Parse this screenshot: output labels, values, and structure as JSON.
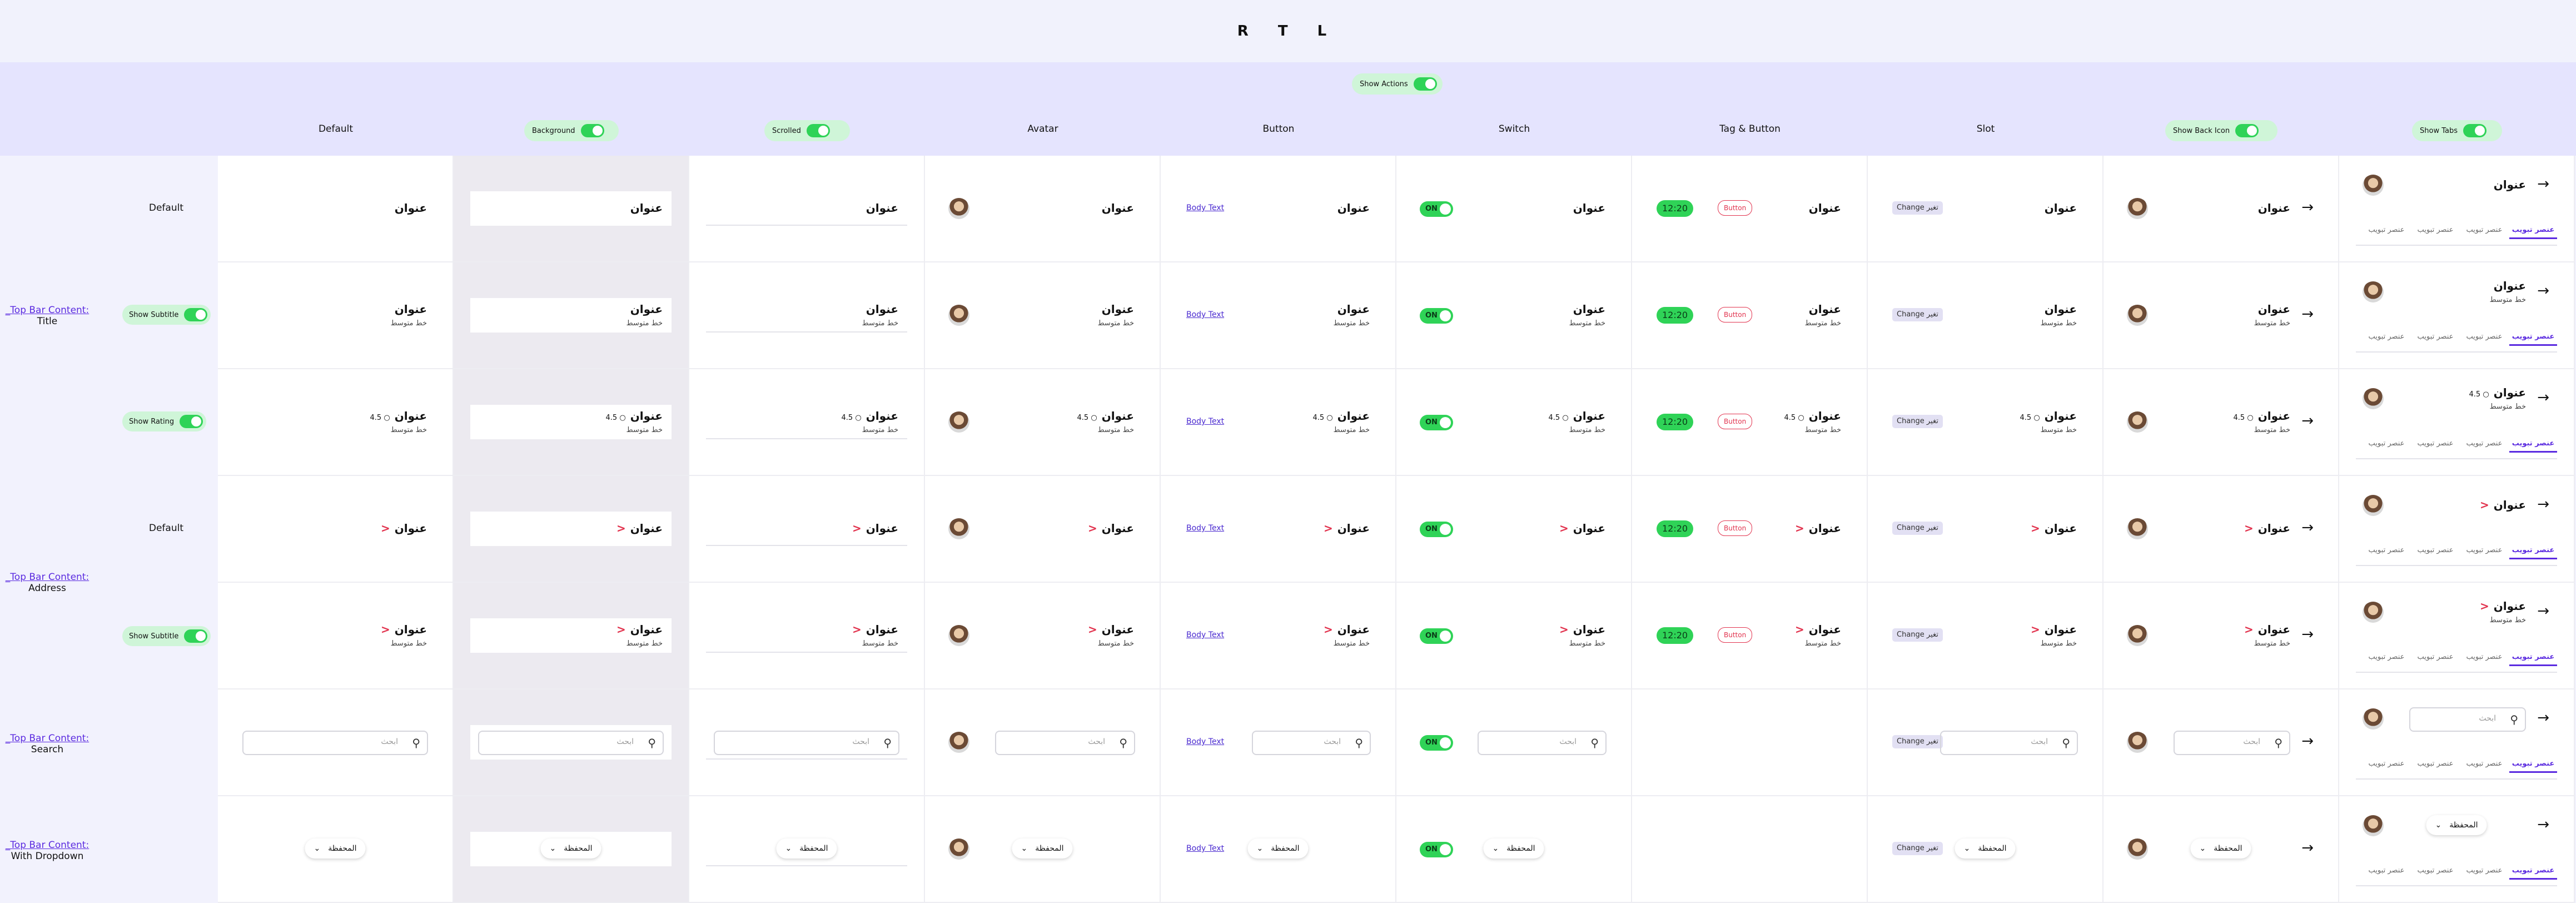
{
  "page_title": "R T L",
  "header": {
    "show_actions_label": "Show Actions",
    "columns": [
      {
        "label": "Default",
        "toggle": false
      },
      {
        "label": "Background",
        "toggle": true
      },
      {
        "label": "Scrolled",
        "toggle": true
      },
      {
        "label": "Avatar",
        "toggle": false
      },
      {
        "label": "Button",
        "toggle": false
      },
      {
        "label": "Switch",
        "toggle": false
      },
      {
        "label": "Tag & Button",
        "toggle": false
      },
      {
        "label": "Slot",
        "toggle": false
      },
      {
        "label": "Show Back Icon",
        "toggle": true
      },
      {
        "label": "Show Tabs",
        "toggle": true
      }
    ]
  },
  "sections": [
    {
      "prefix": "_Top Bar Content:",
      "name": "Title"
    },
    {
      "prefix": "_Top Bar Content:",
      "name": "Address"
    },
    {
      "prefix": "_Top Bar Content:",
      "name": "Search"
    },
    {
      "prefix": "_Top Bar Content:",
      "name": "With Dropdown"
    }
  ],
  "row_labels": {
    "default": "Default",
    "show_subtitle": "Show Subtitle",
    "show_rating": "Show Rating"
  },
  "content": {
    "title": "عنوان",
    "subtitle": "خط متوسط",
    "rating": "4.5",
    "chevron": "<",
    "body_text": "Body Text",
    "on": "ON",
    "time_tag": "12:20",
    "button": "Button",
    "slot_change": "Change",
    "slot_badge": "تغير",
    "search_placeholder": "ابحث",
    "dropdown_label": "المحفظة",
    "tab_item": "عنصر تبويب"
  },
  "colors": {
    "accent": "#5B2BE0",
    "toggle_on": "#2FD357",
    "danger": "#E2344F",
    "header_bg": "#E5E4FE"
  },
  "icons": [
    "search-icon",
    "back-arrow-icon",
    "chevron-down-icon",
    "avatar-image"
  ]
}
